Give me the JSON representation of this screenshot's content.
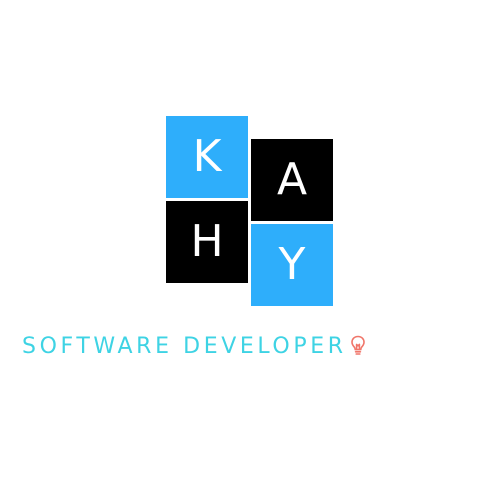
{
  "logo": {
    "tiles": [
      {
        "letter": "K",
        "fill": "#2eaefb"
      },
      {
        "letter": "A",
        "fill": "#000000"
      },
      {
        "letter": "H",
        "fill": "#000000"
      },
      {
        "letter": "Y",
        "fill": "#2eaefb"
      }
    ],
    "letter_color": "#ffffff"
  },
  "tagline": {
    "text": "SOFTWARE DEVELOPER",
    "color": "#3ed3e4",
    "icon": "lightbulb-icon",
    "icon_color": "#f0766a"
  }
}
